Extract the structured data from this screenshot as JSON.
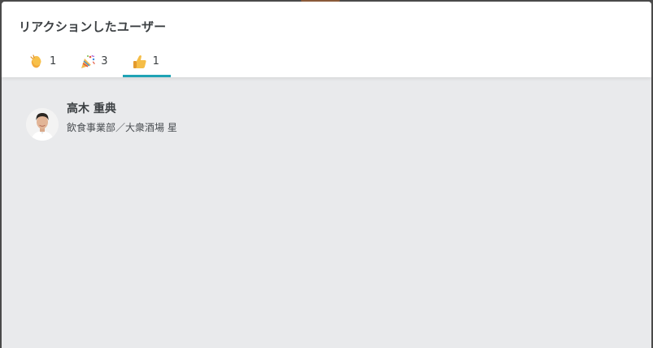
{
  "modal": {
    "title": "リアクションしたユーザー"
  },
  "tabs": [
    {
      "icon": "clapping-hands-icon",
      "count": "1",
      "active": false
    },
    {
      "icon": "party-popper-icon",
      "count": "3",
      "active": false
    },
    {
      "icon": "thumbs-up-icon",
      "count": "1",
      "active": true
    }
  ],
  "users": [
    {
      "name": "高木 重典",
      "department": "飲食事業部／大衆酒場 星"
    }
  ],
  "colors": {
    "accent": "#1fa3b5",
    "header_bg": "#ffffff",
    "body_bg": "#e9eaec",
    "text": "#3c4043"
  }
}
